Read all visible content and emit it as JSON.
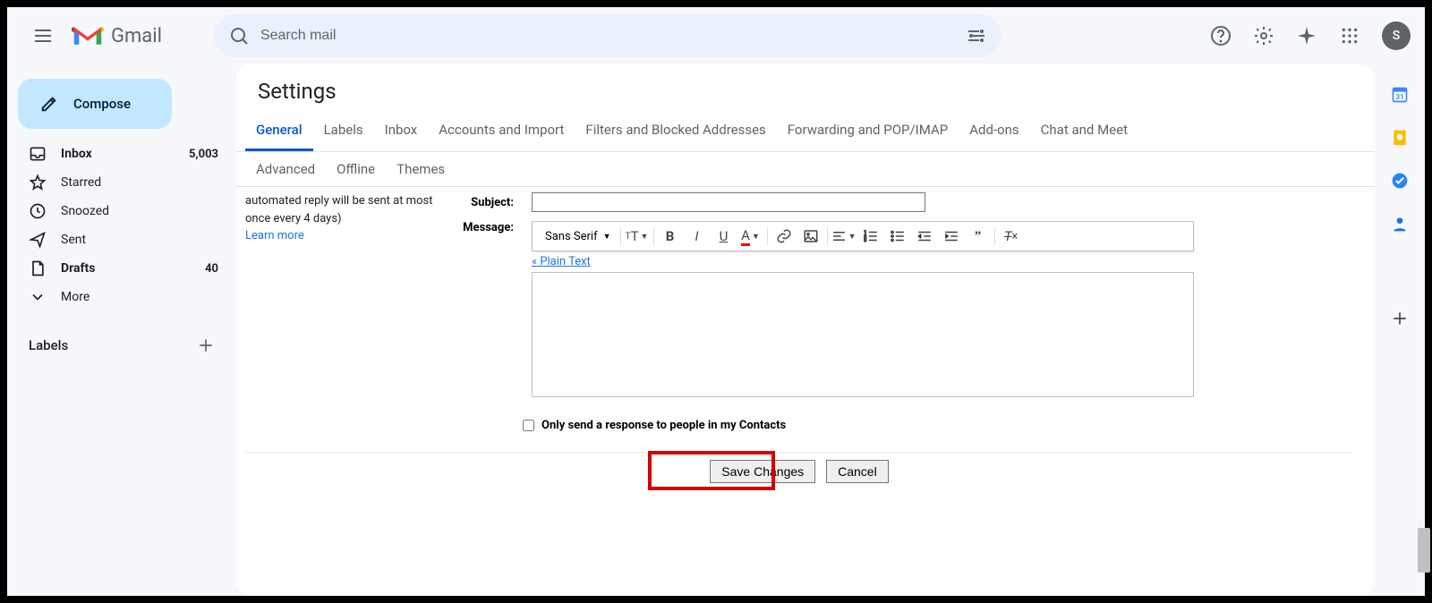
{
  "header": {
    "product": "Gmail",
    "search_placeholder": "Search mail",
    "avatar_initial": "S"
  },
  "compose_label": "Compose",
  "nav": {
    "inbox": {
      "label": "Inbox",
      "count": "5,003"
    },
    "starred": {
      "label": "Starred"
    },
    "snoozed": {
      "label": "Snoozed"
    },
    "sent": {
      "label": "Sent"
    },
    "drafts": {
      "label": "Drafts",
      "count": "40"
    },
    "more": {
      "label": "More"
    }
  },
  "labels_heading": "Labels",
  "settings": {
    "title": "Settings",
    "tabs": {
      "general": "General",
      "labels": "Labels",
      "inbox": "Inbox",
      "accounts": "Accounts and Import",
      "filters": "Filters and Blocked Addresses",
      "forwarding": "Forwarding and POP/IMAP",
      "addons": "Add-ons",
      "chat": "Chat and Meet",
      "advanced": "Advanced",
      "offline": "Offline",
      "themes": "Themes"
    },
    "vacation_desc": "automated reply will be sent at most once every 4 days)",
    "learn_more": "Learn more",
    "subject_label": "Subject:",
    "message_label": "Message:",
    "plain_text": "« Plain Text",
    "font_family": "Sans Serif",
    "only_contacts": "Only send a response to people in my Contacts",
    "save": "Save Changes",
    "cancel": "Cancel"
  }
}
